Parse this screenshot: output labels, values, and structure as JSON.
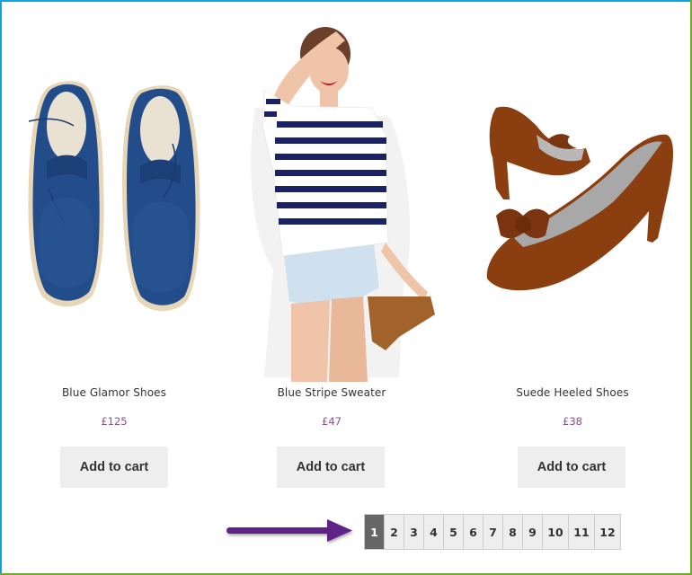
{
  "colors": {
    "frame_top_left": "#0ea3e2",
    "frame_bottom_right": "#73a838",
    "price": "#8b4f8d",
    "button_bg": "#eeeeee",
    "pagination_active": "#666666",
    "arrow": "#5f2387"
  },
  "products": [
    {
      "title": "Blue Glamor Shoes",
      "price": "£125",
      "button_label": "Add to cart",
      "image": "blue-perforated-oxford-shoes"
    },
    {
      "title": "Blue Stripe Sweater",
      "price": "£47",
      "button_label": "Add to cart",
      "image": "woman-in-blue-stripe-sweater"
    },
    {
      "title": "Suede Heeled Shoes",
      "price": "£38",
      "button_label": "Add to cart",
      "image": "brown-suede-bow-heels"
    }
  ],
  "annotation": {
    "icon": "arrow-right-icon"
  },
  "pagination": {
    "current": "1",
    "pages": [
      "1",
      "2",
      "3",
      "4",
      "5",
      "6",
      "7",
      "8",
      "9",
      "10",
      "11",
      "12"
    ]
  }
}
